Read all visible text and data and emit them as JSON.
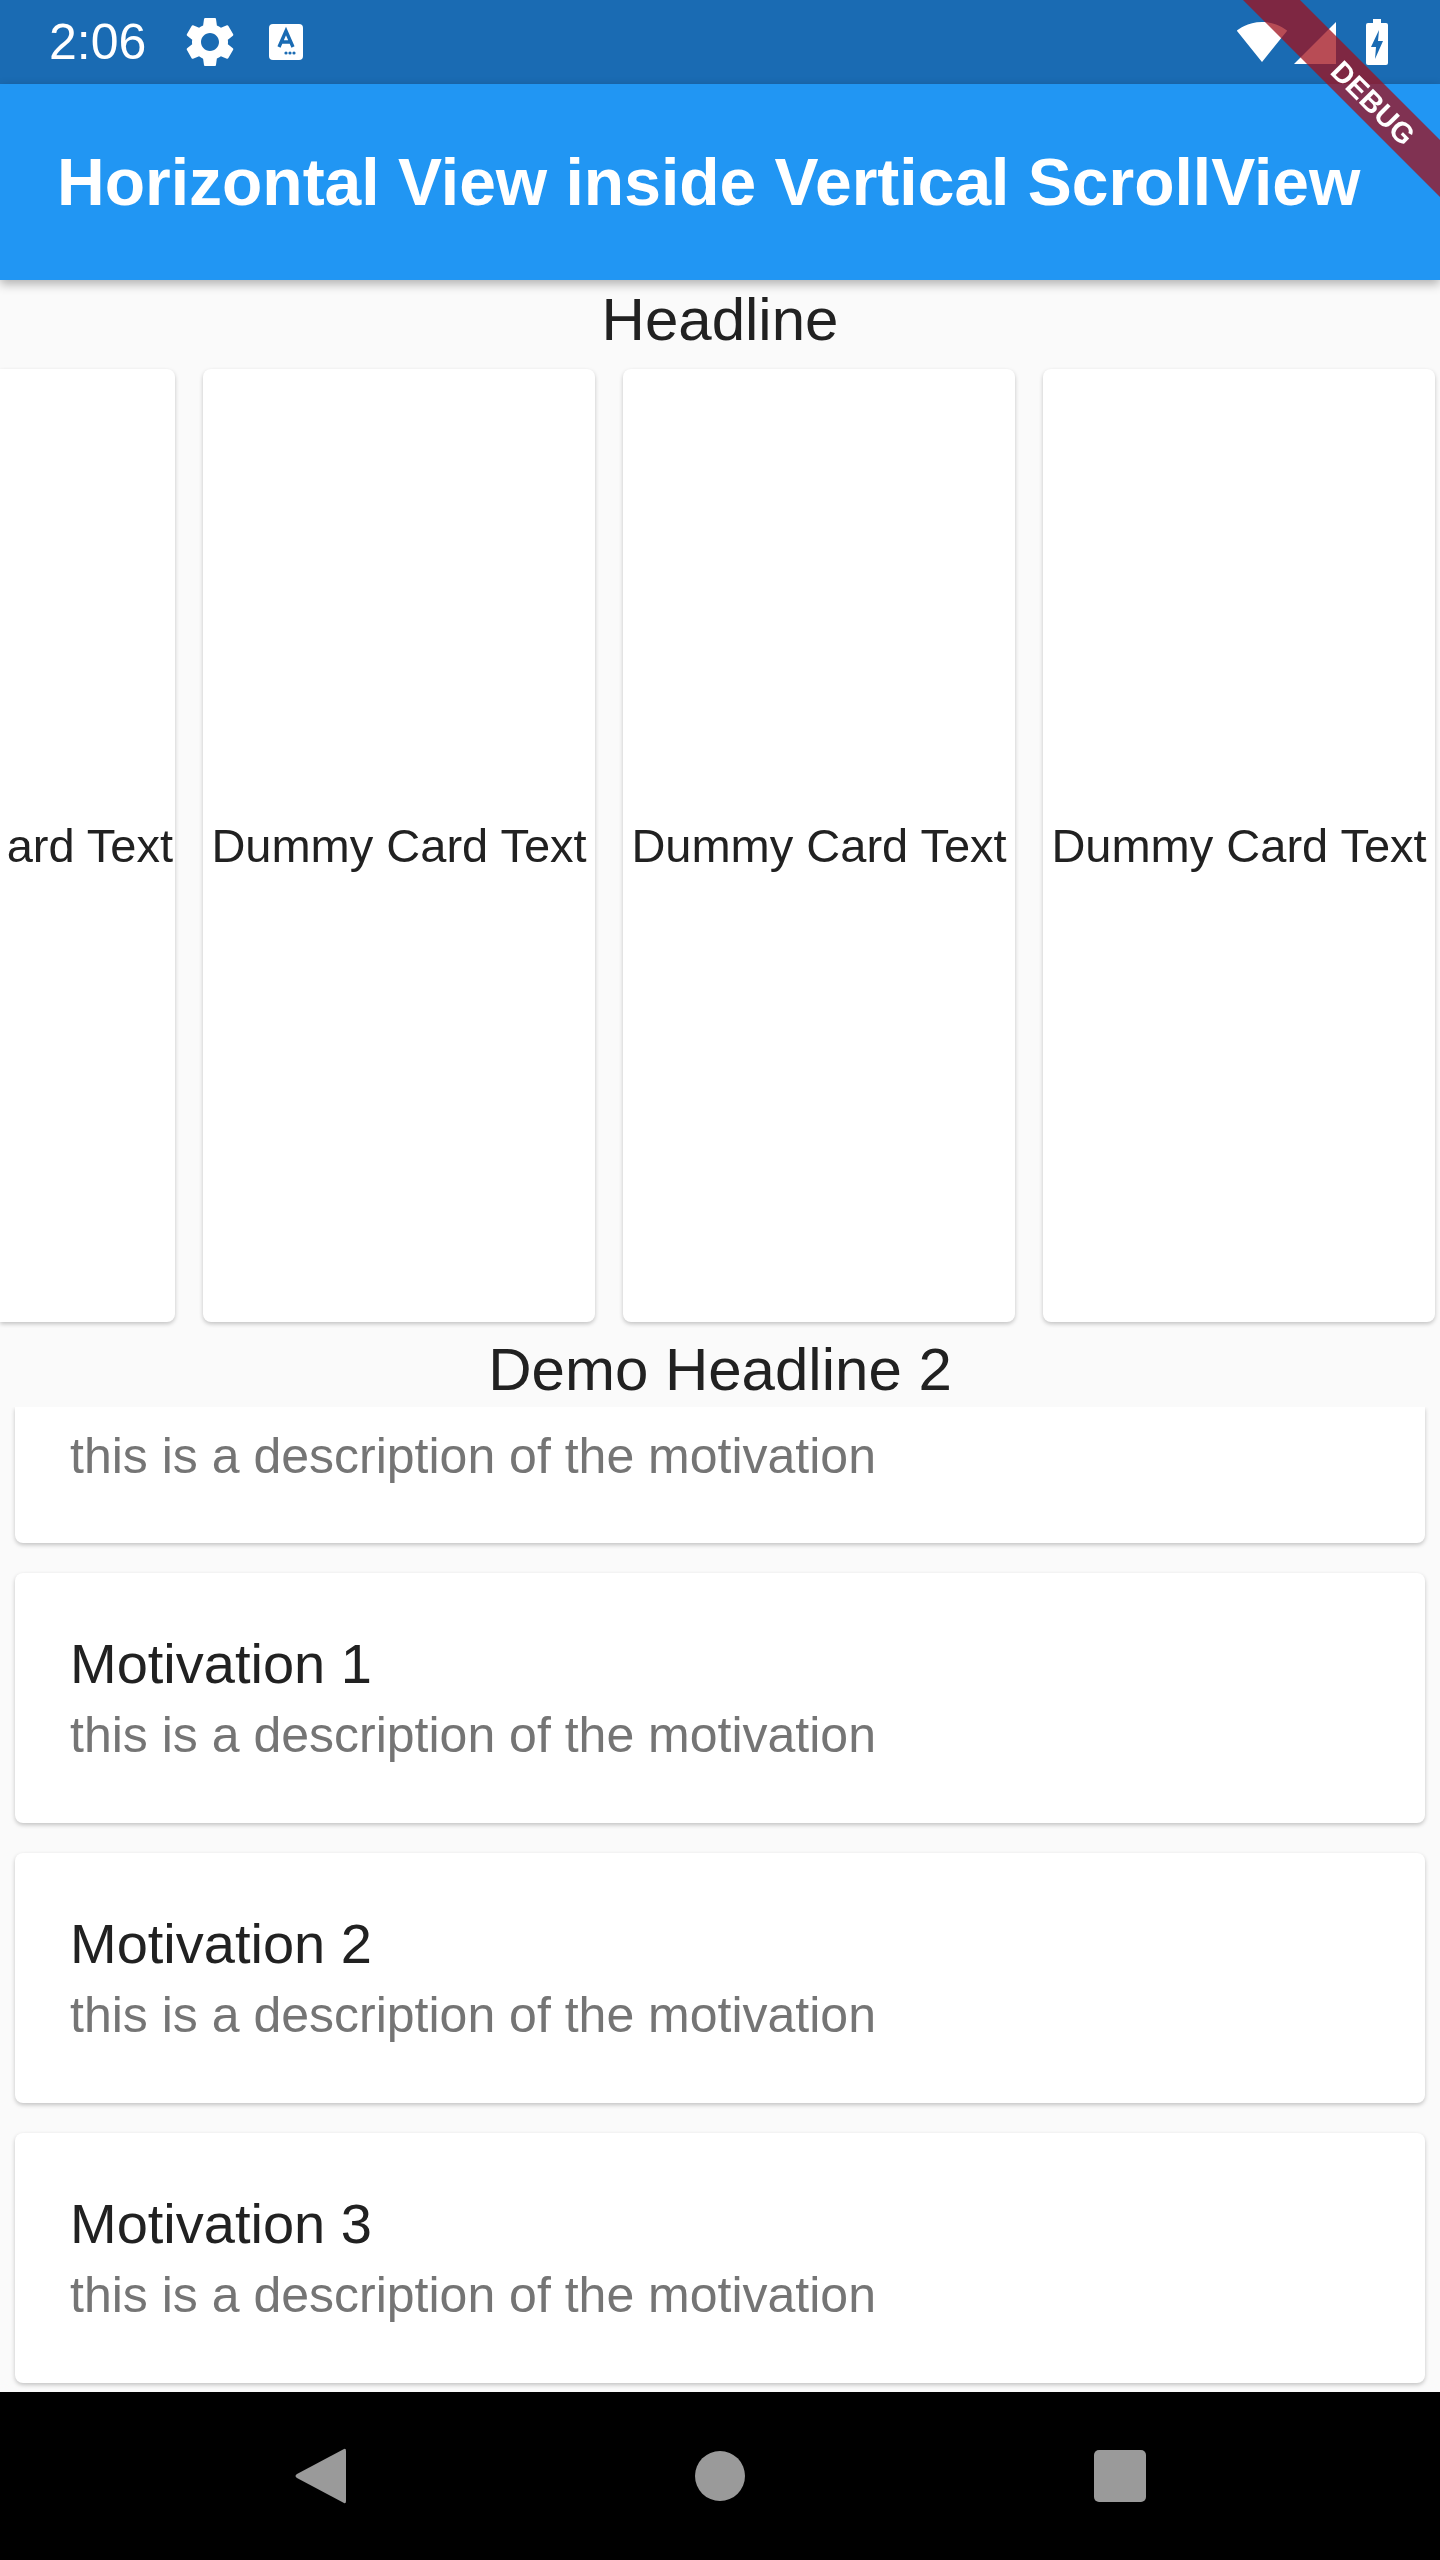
{
  "status_bar": {
    "time": "2:06"
  },
  "app_bar": {
    "title": "Horizontal View inside Vertical ScrollView"
  },
  "debug_banner": {
    "label": "DEBUG"
  },
  "headline": "Headline",
  "cards": [
    {
      "text": "ard Text"
    },
    {
      "text": "Dummy Card Text"
    },
    {
      "text": "Dummy Card Text"
    },
    {
      "text": "Dummy Card Text"
    }
  ],
  "headline_2": "Demo Headline 2",
  "motivations": [
    {
      "description": "this is a description of the motivation"
    },
    {
      "title": "Motivation 1",
      "description": "this is a description of the motivation"
    },
    {
      "title": "Motivation 2",
      "description": "this is a description of the motivation"
    },
    {
      "title": "Motivation 3",
      "description": "this is a description of the motivation"
    }
  ]
}
